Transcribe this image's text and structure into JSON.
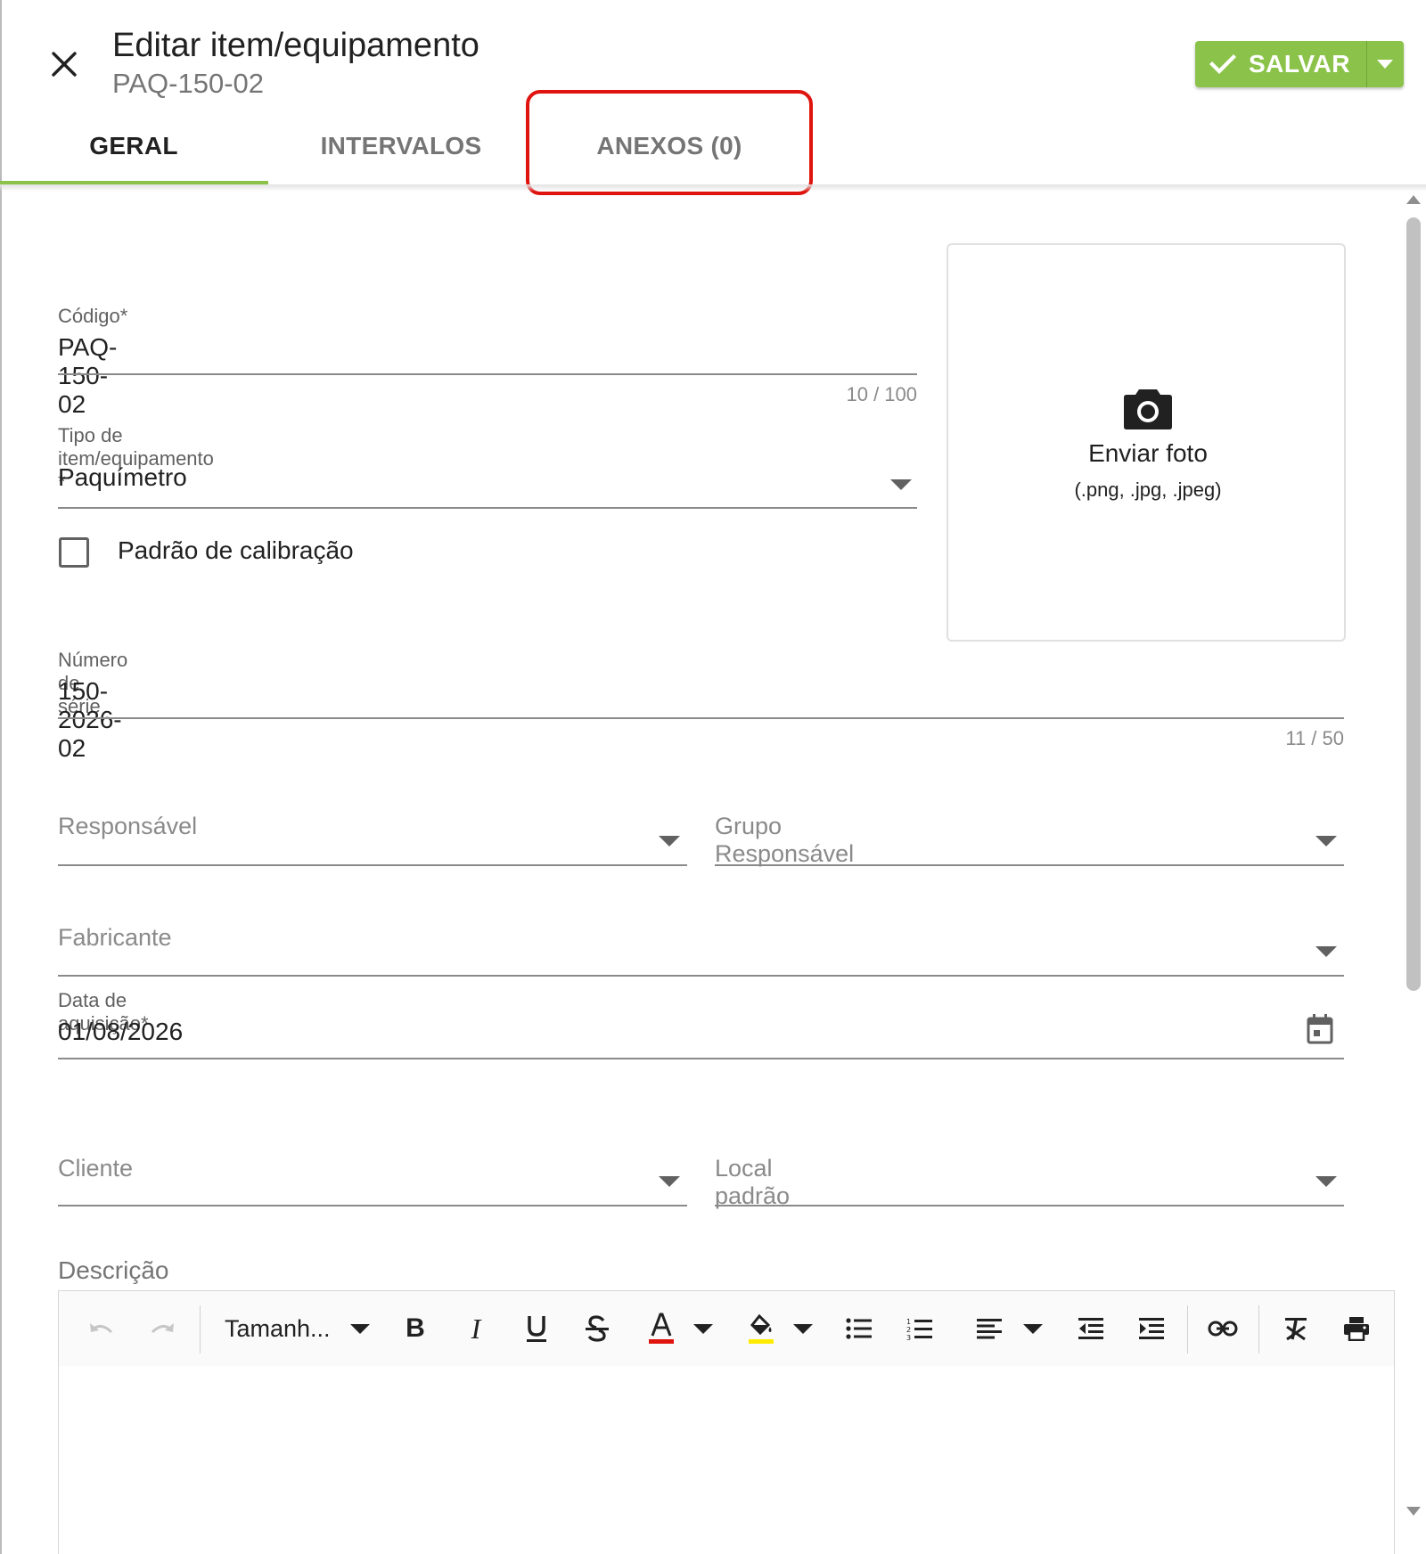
{
  "header": {
    "title": "Editar item/equipamento",
    "subtitle": "PAQ-150-02",
    "close_icon": "close-icon",
    "save_label": "SALVAR",
    "save_color": "#8bc34a"
  },
  "tabs": [
    {
      "label": "GERAL",
      "active": true
    },
    {
      "label": "INTERVALOS",
      "active": false
    },
    {
      "label": "ANEXOS (0)",
      "active": false,
      "highlighted": true
    }
  ],
  "form": {
    "codigo": {
      "label": "Código*",
      "value": "PAQ-150-02",
      "counter": "10 / 100"
    },
    "tipo": {
      "label": "Tipo de item/equipamento *",
      "value": "Paquímetro"
    },
    "padrao": {
      "label": "Padrão de calibração",
      "checked": false
    },
    "serie": {
      "label": "Número de série",
      "value": "150-2026-02",
      "counter": "11 / 50"
    },
    "responsavel": {
      "placeholder": "Responsável"
    },
    "grupo": {
      "placeholder": "Grupo Responsável"
    },
    "fabricante": {
      "placeholder": "Fabricante"
    },
    "aquisicao": {
      "label": "Data de aquisição*",
      "value": "01/08/2026"
    },
    "cliente": {
      "placeholder": "Cliente"
    },
    "local": {
      "placeholder": "Local padrão"
    },
    "descricao": {
      "label": "Descrição"
    }
  },
  "photo": {
    "label": "Enviar foto",
    "formats": "(.png, .jpg, .jpeg)",
    "icon": "camera-icon"
  },
  "editor": {
    "font_size_label": "Tamanh...",
    "tools": [
      "undo",
      "redo",
      "font-size",
      "bold",
      "italic",
      "underline",
      "strikethrough",
      "text-color",
      "highlight-color",
      "bullet-list",
      "numbered-list",
      "align",
      "outdent",
      "indent",
      "link",
      "clear-format",
      "print"
    ],
    "text_color": "#e0140f",
    "highlight_color": "#ffeb00"
  },
  "highlight_color": "#e0140f"
}
